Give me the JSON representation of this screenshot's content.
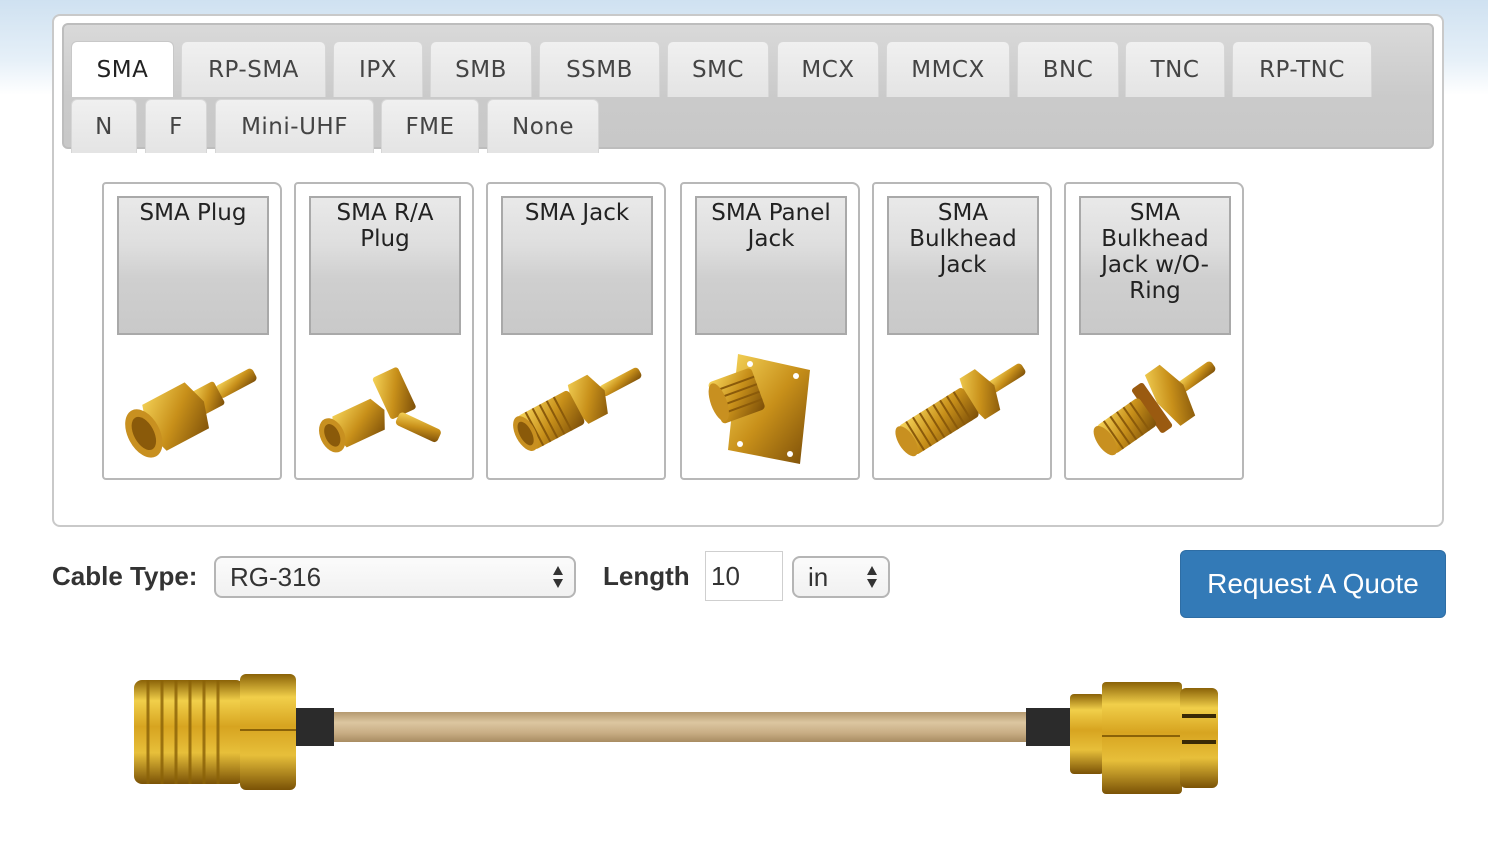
{
  "connector_tabs": {
    "active": "SMA",
    "row1": [
      "SMA",
      "RP-SMA",
      "IPX",
      "SMB",
      "SSMB",
      "SMC",
      "MCX",
      "MMCX",
      "BNC",
      "TNC",
      "RP-TNC"
    ],
    "row2": [
      "N",
      "F",
      "Mini-UHF",
      "FME",
      "None"
    ]
  },
  "variants": [
    {
      "label": "SMA Plug",
      "icon": "sma-plug-connector-photo"
    },
    {
      "label": "SMA R/A Plug",
      "icon": "sma-right-angle-plug-connector-photo"
    },
    {
      "label": "SMA Jack",
      "icon": "sma-jack-connector-photo"
    },
    {
      "label": "SMA Panel Jack",
      "icon": "sma-panel-jack-connector-photo"
    },
    {
      "label": "SMA Bulkhead Jack",
      "icon": "sma-bulkhead-jack-connector-photo"
    },
    {
      "label": "SMA Bulkhead Jack w/O-Ring",
      "icon": "sma-bulkhead-jack-oring-connector-photo"
    }
  ],
  "controls": {
    "cable_type_label": "Cable Type:",
    "cable_type_value": "RG-316",
    "length_label": "Length",
    "length_value": "10",
    "unit_value": "in",
    "quote_button": "Request A Quote"
  },
  "colors": {
    "accent": "#337ab7",
    "gold": "#d4a520",
    "cable_jacket": "#c8ad84"
  }
}
